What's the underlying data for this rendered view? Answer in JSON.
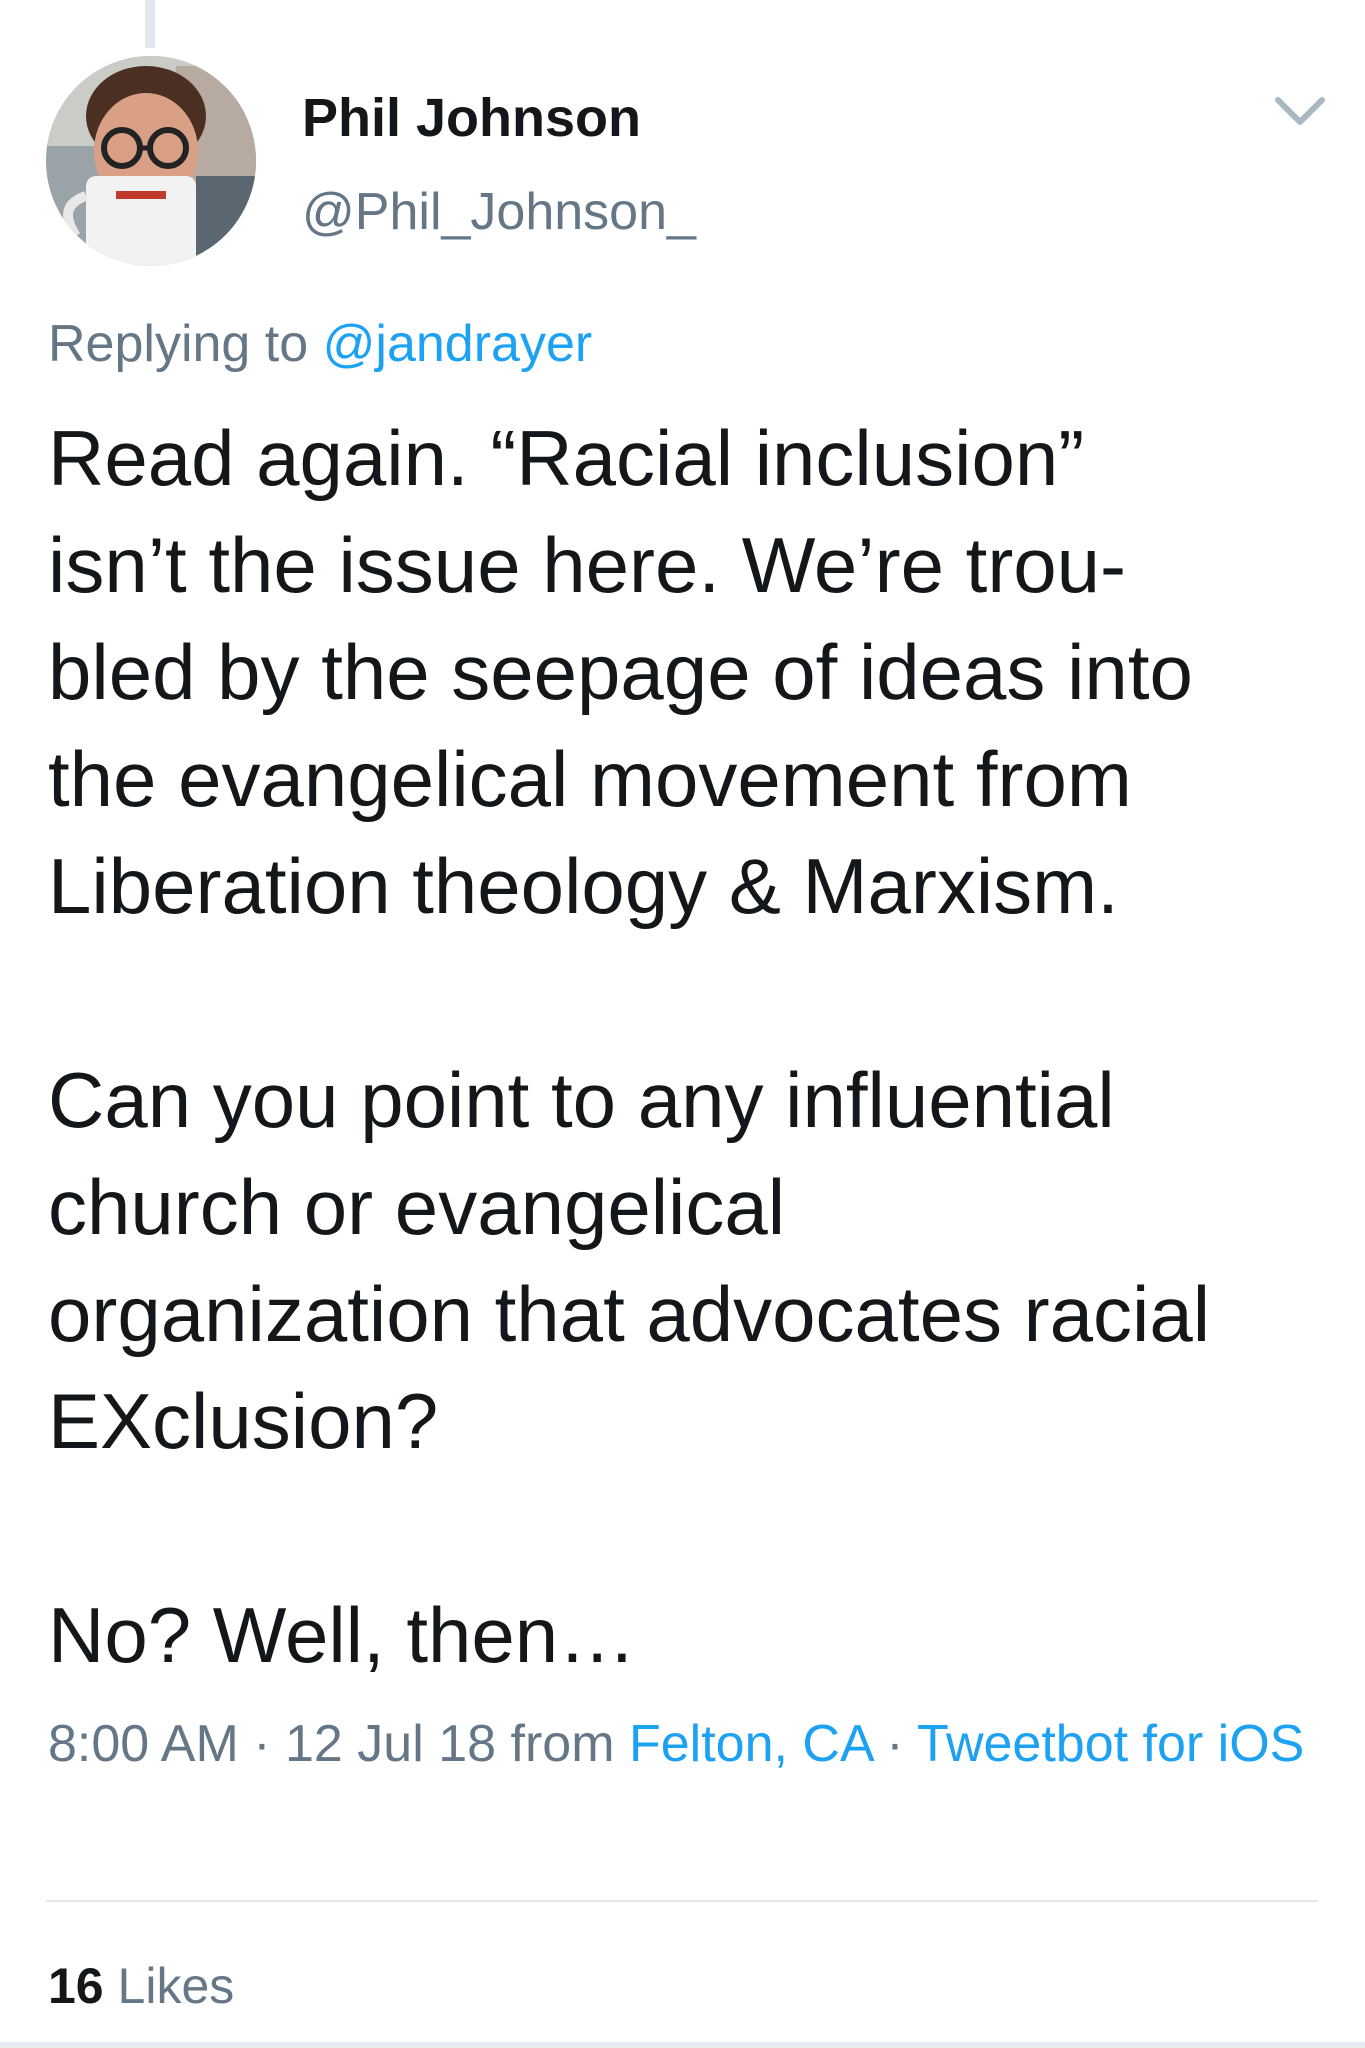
{
  "tweet": {
    "author": {
      "name": "Phil Johnson",
      "handle": "@Phil_Johnson_",
      "avatar_icon": "profile-photo-man-with-coffee-mug"
    },
    "reply": {
      "prefix": "Replying to",
      "mention": "@jandrayer"
    },
    "body": {
      "paragraph_1": [
        "Read again. “Racial inclusion”",
        "isn’t the issue here. We’re trou-",
        "bled by the seepage of ideas into",
        "the evangelical movement from",
        "Liberation theology & Marxism."
      ],
      "paragraph_2": [
        "Can you point to any influential",
        "church or evangelical",
        "organization that advocates racial",
        "EXclusion?"
      ],
      "paragraph_3": [
        "No? Well, then…"
      ]
    },
    "meta": {
      "time": "8:00 AM",
      "sep1": " · ",
      "date": "12 Jul 18",
      "from_word": " from ",
      "location": "Felton, CA",
      "sep2": " · ",
      "client": "Tweetbot for iOS"
    },
    "likes": {
      "count": "16",
      "label": "Likes"
    },
    "menu_icon": "chevron-down-icon",
    "colors": {
      "text": "#14171a",
      "secondary": "#657786",
      "link": "#1da1f2",
      "divider": "#e1e8ed"
    }
  }
}
